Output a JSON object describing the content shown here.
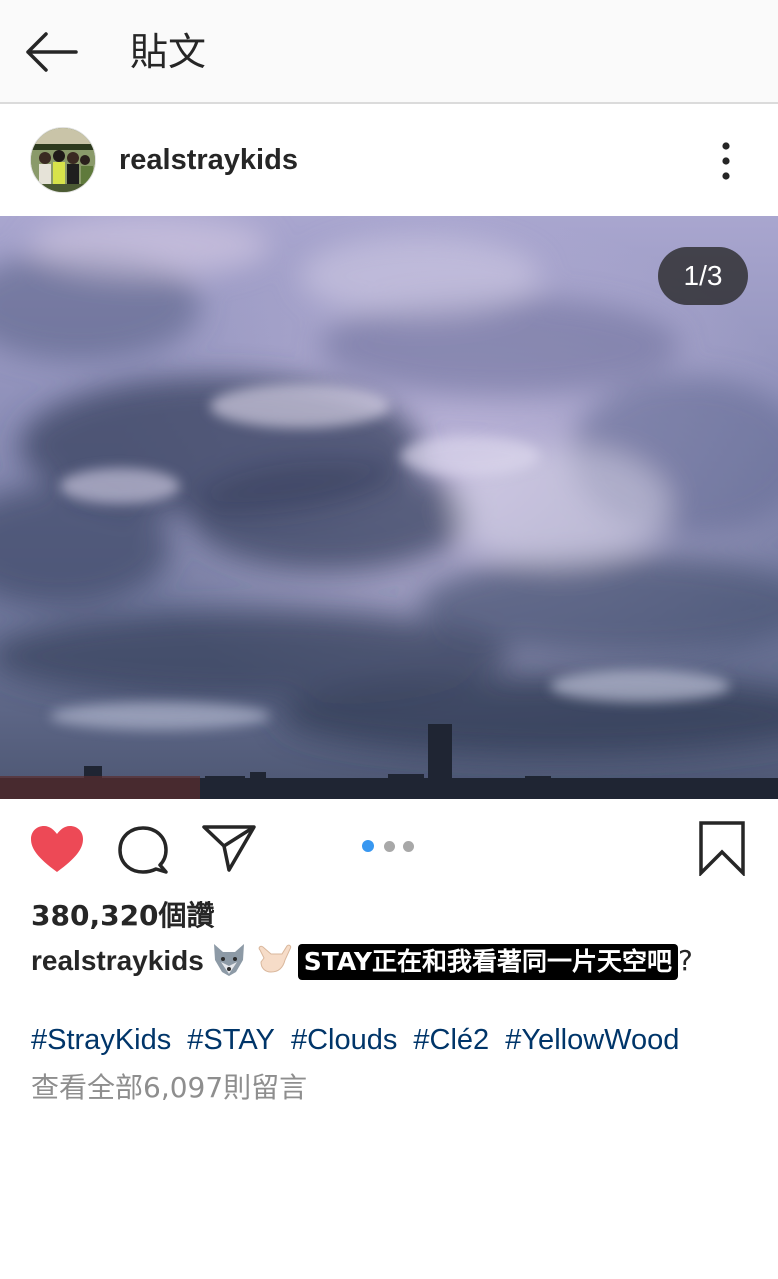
{
  "topbar": {
    "back_icon": "arrow-left-icon",
    "title": "貼文"
  },
  "post": {
    "username": "realstraykids",
    "more_icon": "vertical-ellipsis-icon",
    "image_counter": "1/3",
    "carousel": {
      "current": 1,
      "total": 3
    },
    "actions": {
      "like_icon": "heart-filled-icon",
      "like_color": "#ed4956",
      "comment_icon": "speech-bubble-icon",
      "share_icon": "paper-plane-icon",
      "save_icon": "bookmark-icon",
      "active_dot_color": "#3897f0"
    },
    "likes": "380,320個讚",
    "caption": {
      "username": "realstraykids",
      "emojis": [
        "wolf-emoji",
        "call-me-hand-emoji"
      ],
      "sticker_text": "STAY正在和我看著同一片天空吧",
      "tail": "?"
    },
    "hashtags": [
      "#StrayKids",
      "#STAY",
      "#Clouds",
      "#Clé2",
      "#YellowWood"
    ],
    "view_comments": "查看全部6,097則留言",
    "hashtag_color": "#003569"
  }
}
